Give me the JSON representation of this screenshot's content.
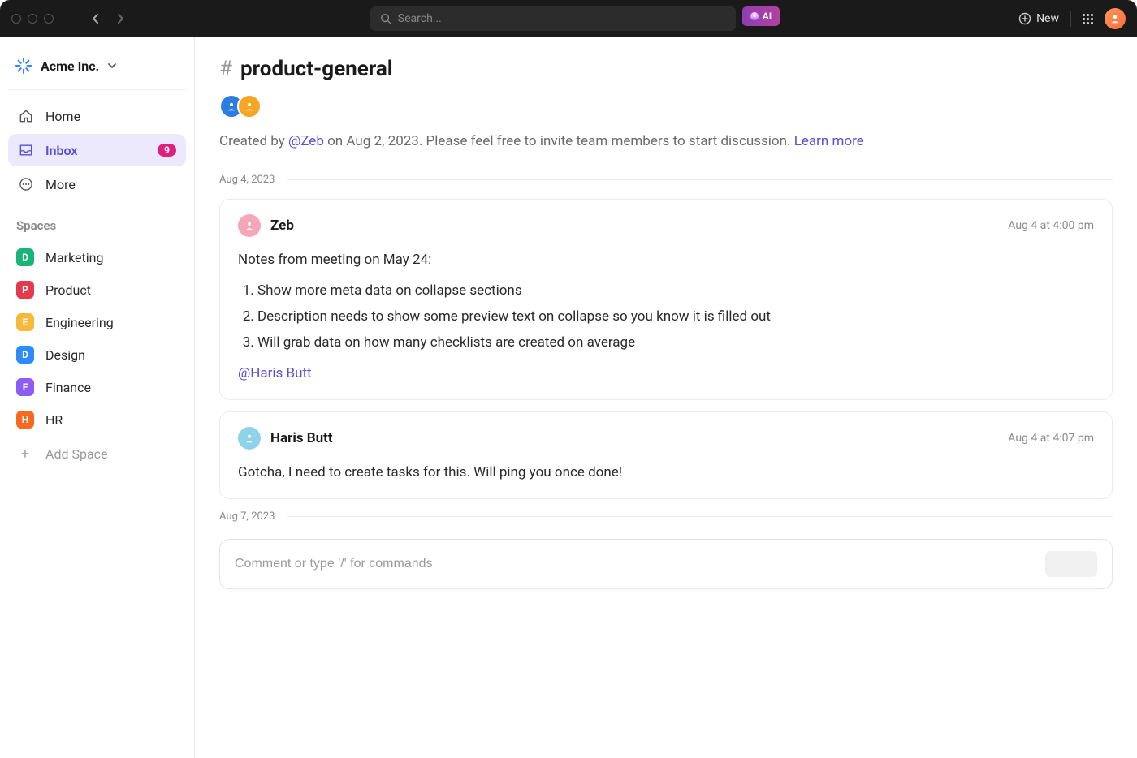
{
  "topbar": {
    "search_placeholder": "Search...",
    "ai_label": "AI",
    "new_label": "New"
  },
  "workspace": {
    "name": "Acme Inc."
  },
  "nav": {
    "home": "Home",
    "inbox": "Inbox",
    "inbox_badge": "9",
    "more": "More"
  },
  "spaces_title": "Spaces",
  "spaces": [
    {
      "letter": "D",
      "label": "Marketing",
      "color": "#18b47a"
    },
    {
      "letter": "P",
      "label": "Product",
      "color": "#e6394b"
    },
    {
      "letter": "E",
      "label": "Engineering",
      "color": "#f6b93b"
    },
    {
      "letter": "D",
      "label": "Design",
      "color": "#2e8bfb"
    },
    {
      "letter": "F",
      "label": "Finance",
      "color": "#8b5cf6"
    },
    {
      "letter": "H",
      "label": "HR",
      "color": "#f56a1e"
    }
  ],
  "add_space": "Add Space",
  "channel": {
    "name": "product-general",
    "members_avatars": [
      {
        "color": "#2b7de1"
      },
      {
        "color": "#f6a623"
      }
    ],
    "created_prefix": "Created by ",
    "created_mention": "@Zeb",
    "created_mid": " on Aug 2, 2023. Please feel free to invite team members to start discussion. ",
    "learn_more": "Learn more"
  },
  "dates": {
    "d1": "Aug 4, 2023",
    "d2": "Aug 7, 2023"
  },
  "messages": [
    {
      "author": "Zeb",
      "avatar_color": "#f4a7b9",
      "time": "Aug 4 at 4:00 pm",
      "lead": "Notes from meeting on May 24:",
      "items": [
        "Show more meta data on collapse sections",
        "Description needs to show some preview text on collapse so you know it is filled out",
        "Will grab data on how many checklists are created on average"
      ],
      "mention": "@Haris Butt"
    },
    {
      "author": "Haris Butt",
      "avatar_color": "#8fd3e8",
      "time": "Aug 4 at 4:07 pm",
      "text": "Gotcha, I need to create tasks for this. Will ping you once done!"
    }
  ],
  "composer": {
    "placeholder": "Comment or type '/' for commands"
  }
}
